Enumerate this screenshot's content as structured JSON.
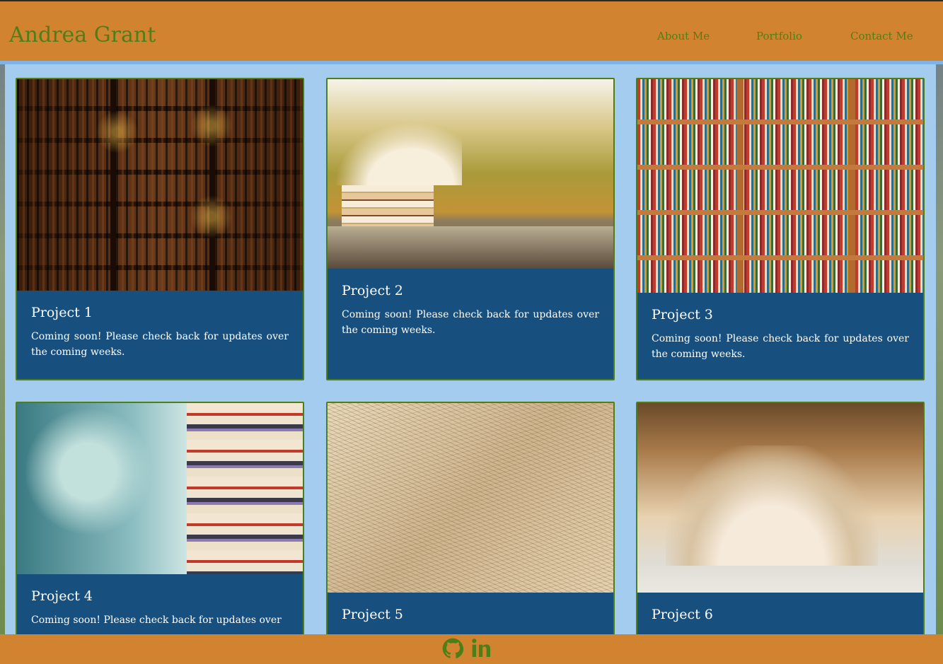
{
  "header": {
    "brand": "Andrea Grant",
    "nav": [
      {
        "label": "About Me"
      },
      {
        "label": "Portfolio"
      },
      {
        "label": "Contact Me"
      }
    ]
  },
  "projects": [
    {
      "title": "Project 1",
      "description": "Coming soon! Please check back for updates over the coming weeks.",
      "image": "dark library bookshelves with candles"
    },
    {
      "title": "Project 2",
      "description": "Coming soon! Please check back for updates over the coming weeks.",
      "image": "stack of open books outdoors"
    },
    {
      "title": "Project 3",
      "description": "Coming soon! Please check back for updates over the coming weeks.",
      "image": "colorful bookshelf"
    },
    {
      "title": "Project 4",
      "description": "Coming soon! Please check back for updates over",
      "image": "stacked books with teal background"
    },
    {
      "title": "Project 5",
      "description": "",
      "image": "scattered book pages"
    },
    {
      "title": "Project 6",
      "description": "",
      "image": "open book on table"
    }
  ],
  "footer": {
    "icons": [
      "github-icon",
      "linkedin-icon"
    ]
  },
  "colors": {
    "header_bg": "#d28330",
    "accent_green": "#4e7f17",
    "card_bg": "#17507f",
    "page_bg": "#a4ccee"
  }
}
